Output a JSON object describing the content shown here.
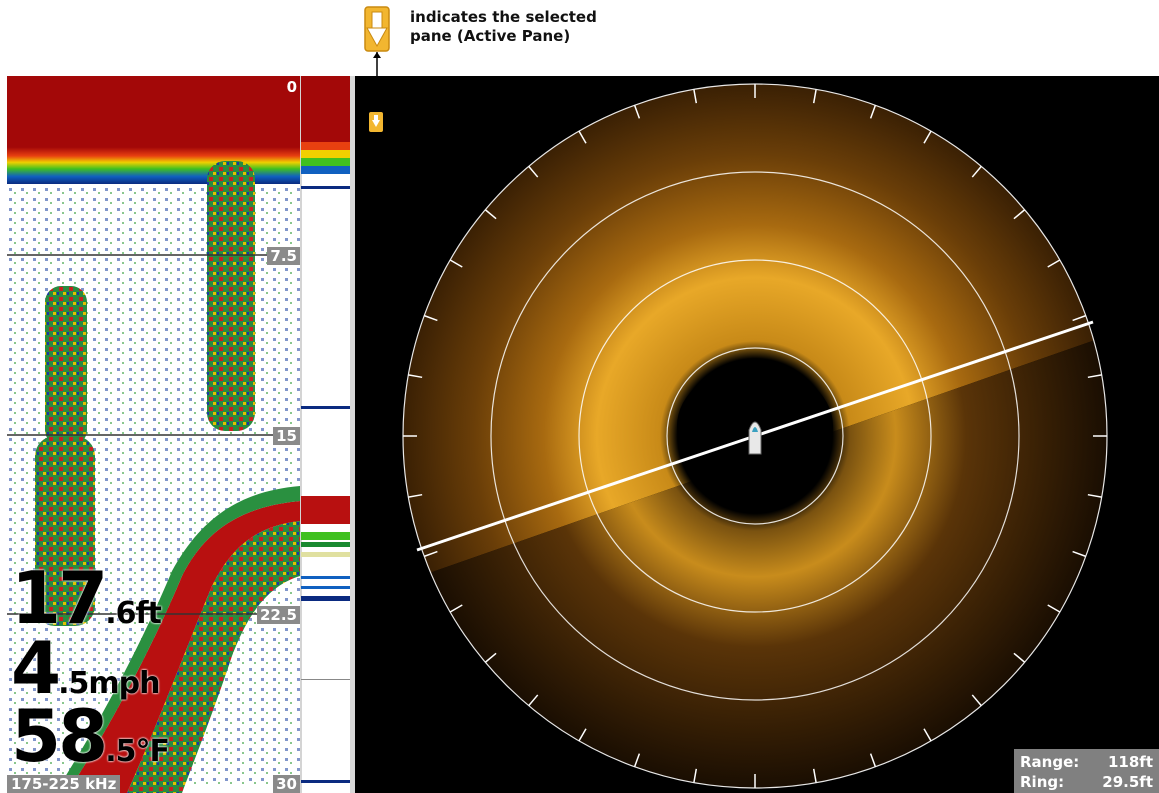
{
  "annotation": {
    "line1": "indicates the selected",
    "line2": "pane (Active Pane)",
    "icon": "active-pane-arrow-icon"
  },
  "sonar": {
    "depth_scale": [
      "0",
      "7.5",
      "15",
      "22.5",
      "30"
    ],
    "frequency": "175-225 kHz",
    "depth": {
      "whole": "17",
      "fraction": ".6ft"
    },
    "speed": {
      "whole": "4",
      "fraction": ".5mph"
    },
    "temperature": {
      "whole": "58",
      "fraction": ".5°F"
    }
  },
  "imaging": {
    "range_label": "Range:",
    "range_value": "118ft",
    "ring_label": "Ring:",
    "ring_value": "29.5ft"
  },
  "colors": {
    "active_marker": "#f2b630",
    "sonar_return": "#c81818",
    "imaging_palette": "#d9a020",
    "info_box": "#808080"
  }
}
